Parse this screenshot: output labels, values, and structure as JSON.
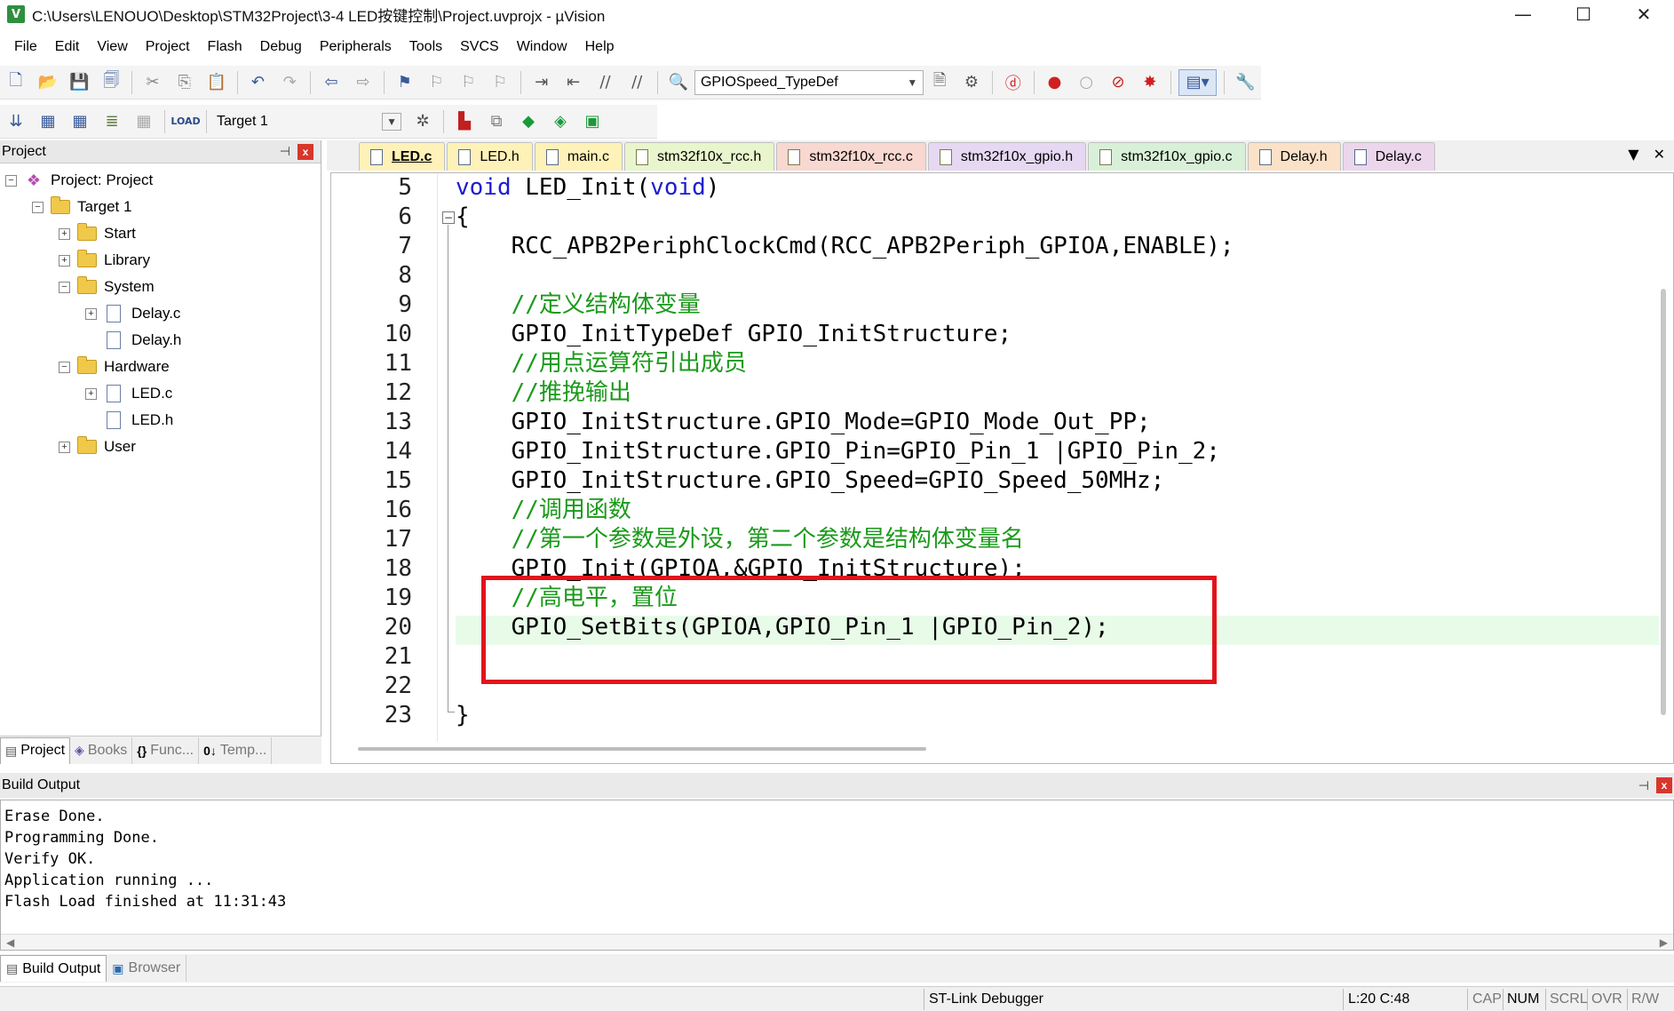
{
  "window": {
    "title": "C:\\Users\\LENOUO\\Desktop\\STM32Project\\3-4 LED按键控制\\Project.uvprojx - µVision",
    "app_icon": "V",
    "minimize": "—",
    "maximize": "☐",
    "close": "✕"
  },
  "menu": [
    "File",
    "Edit",
    "View",
    "Project",
    "Flash",
    "Debug",
    "Peripherals",
    "Tools",
    "SVCS",
    "Window",
    "Help"
  ],
  "toolbar": {
    "find_combo": "GPIOSpeed_TypeDef",
    "target_combo": "Target 1"
  },
  "project_panel": {
    "title": "Project",
    "pin": "⊣",
    "close": "x",
    "tree": [
      {
        "label": "Project: Project",
        "level": 0,
        "expander": "−",
        "icon": "project"
      },
      {
        "label": "Target 1",
        "level": 1,
        "expander": "−",
        "icon": "folder"
      },
      {
        "label": "Start",
        "level": 2,
        "expander": "+",
        "icon": "folder"
      },
      {
        "label": "Library",
        "level": 2,
        "expander": "+",
        "icon": "folder"
      },
      {
        "label": "System",
        "level": 2,
        "expander": "−",
        "icon": "folder"
      },
      {
        "label": "Delay.c",
        "level": 3,
        "expander": "+",
        "icon": "file"
      },
      {
        "label": "Delay.h",
        "level": 3,
        "expander": "",
        "icon": "file"
      },
      {
        "label": "Hardware",
        "level": 2,
        "expander": "−",
        "icon": "folder"
      },
      {
        "label": "LED.c",
        "level": 3,
        "expander": "+",
        "icon": "file"
      },
      {
        "label": "LED.h",
        "level": 3,
        "expander": "",
        "icon": "file"
      },
      {
        "label": "User",
        "level": 2,
        "expander": "+",
        "icon": "folder"
      }
    ],
    "tabs": [
      {
        "label": "Project",
        "icon": "▤"
      },
      {
        "label": "Books",
        "icon": "◈"
      },
      {
        "label": "Func...",
        "icon": "{}"
      },
      {
        "label": "Temp...",
        "icon": "0↓"
      }
    ]
  },
  "editor_tabs": [
    {
      "label": "LED.c",
      "color": "#fff2b8",
      "active": true
    },
    {
      "label": "LED.h",
      "color": "#fff2b8"
    },
    {
      "label": "main.c",
      "color": "#fff2b8"
    },
    {
      "label": "stm32f10x_rcc.h",
      "color": "#e9f5cc"
    },
    {
      "label": "stm32f10x_rcc.c",
      "color": "#f8d8d0"
    },
    {
      "label": "stm32f10x_gpio.h",
      "color": "#e6d8f2"
    },
    {
      "label": "stm32f10x_gpio.c",
      "color": "#d9f0d8"
    },
    {
      "label": "Delay.h",
      "color": "#fbe1c7"
    },
    {
      "label": "Delay.c",
      "color": "#ecd6ec"
    }
  ],
  "editor_tabs_controls": {
    "dropdown": "▼",
    "close": "✕"
  },
  "code": {
    "line_numbers": [
      "5",
      "6",
      "7",
      "8",
      "9",
      "10",
      "11",
      "12",
      "13",
      "14",
      "15",
      "16",
      "17",
      "18",
      "19",
      "20",
      "21",
      "22",
      "23"
    ],
    "fold_open": "−",
    "highlighted_line": 20,
    "lines": [
      {
        "n": "5",
        "parts": [
          {
            "t": "void",
            "c": "kw"
          },
          {
            "t": " LED_Init(",
            "c": ""
          },
          {
            "t": "void",
            "c": "kw"
          },
          {
            "t": ")",
            "c": ""
          }
        ]
      },
      {
        "n": "6",
        "parts": [
          {
            "t": "{",
            "c": ""
          }
        ]
      },
      {
        "n": "7",
        "parts": [
          {
            "t": "    RCC_APB2PeriphClockCmd(RCC_APB2Periph_GPIOA,ENABLE);",
            "c": ""
          }
        ]
      },
      {
        "n": "8",
        "parts": []
      },
      {
        "n": "9",
        "parts": [
          {
            "t": "    //定义结构体变量",
            "c": "cm"
          }
        ]
      },
      {
        "n": "10",
        "parts": [
          {
            "t": "    GPIO_InitTypeDef GPIO_InitStructure;",
            "c": ""
          }
        ]
      },
      {
        "n": "11",
        "parts": [
          {
            "t": "    //用点运算符引出成员",
            "c": "cm"
          }
        ]
      },
      {
        "n": "12",
        "parts": [
          {
            "t": "    //推挽输出",
            "c": "cm"
          }
        ]
      },
      {
        "n": "13",
        "parts": [
          {
            "t": "    GPIO_InitStructure.GPIO_Mode=GPIO_Mode_Out_PP;",
            "c": ""
          }
        ]
      },
      {
        "n": "14",
        "parts": [
          {
            "t": "    GPIO_InitStructure.GPIO_Pin=GPIO_Pin_1 |GPIO_Pin_2;",
            "c": ""
          }
        ]
      },
      {
        "n": "15",
        "parts": [
          {
            "t": "    GPIO_InitStructure.GPIO_Speed=GPIO_Speed_50MHz;",
            "c": ""
          }
        ]
      },
      {
        "n": "16",
        "parts": [
          {
            "t": "    //调用函数",
            "c": "cm"
          }
        ]
      },
      {
        "n": "17",
        "parts": [
          {
            "t": "    //第一个参数是外设，第二个参数是结构体变量名",
            "c": "cm"
          }
        ]
      },
      {
        "n": "18",
        "parts": [
          {
            "t": "    GPIO_Init(GPIOA,&GPIO_InitStructure);",
            "c": ""
          }
        ]
      },
      {
        "n": "19",
        "parts": [
          {
            "t": "    //高电平，置位",
            "c": "cm"
          }
        ]
      },
      {
        "n": "20",
        "parts": [
          {
            "t": "    GPIO_SetBits(GPIOA,GPIO_Pin_1 |GPIO_Pin_2);",
            "c": ""
          }
        ]
      },
      {
        "n": "21",
        "parts": []
      },
      {
        "n": "22",
        "parts": []
      },
      {
        "n": "23",
        "parts": [
          {
            "t": "}",
            "c": ""
          }
        ]
      }
    ]
  },
  "build_output": {
    "title": "Build Output",
    "lines": [
      "Erase Done.",
      "Programming Done.",
      "Verify OK.",
      "Application running ...",
      "Flash Load finished at 11:31:43"
    ],
    "scroll_left": "◀",
    "scroll_right": "▶",
    "tabs": [
      {
        "label": "Build Output",
        "icon": "▤"
      },
      {
        "label": "Browser",
        "icon": "▣"
      }
    ]
  },
  "statusbar": {
    "debugger": "ST-Link Debugger",
    "position": "L:20 C:48",
    "cap": "CAP",
    "num": "NUM",
    "scrl": "SCRL",
    "ovr": "OVR",
    "rw": "R/W"
  },
  "colors": {
    "keyword": "#1c1cd0",
    "comment": "#1b9a1b",
    "highlight": "#e8fbe8",
    "annotation_box": "#e2141c"
  }
}
